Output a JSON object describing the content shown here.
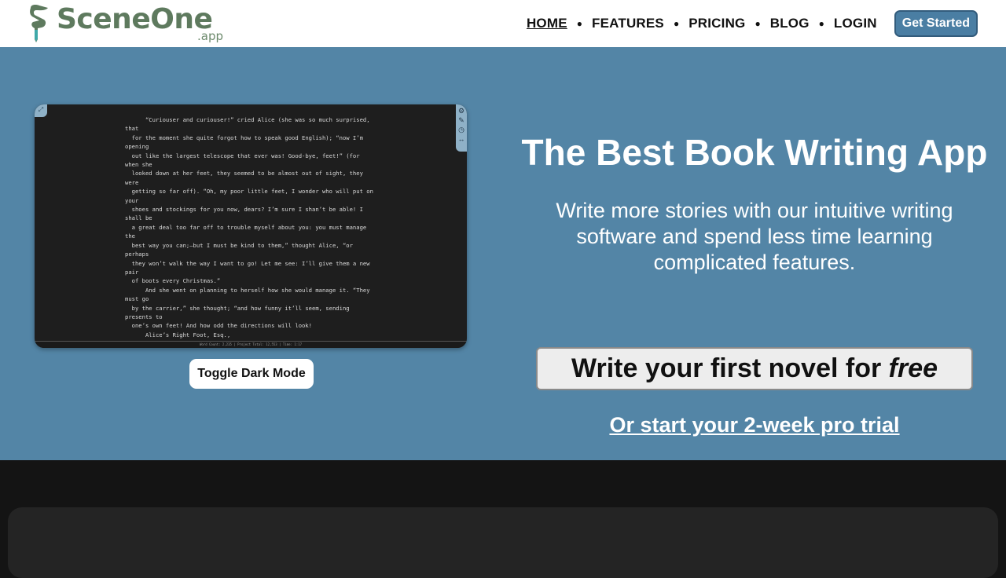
{
  "brand": {
    "name": "SceneOne",
    "suffix": ".app",
    "color": "#5e7a5e"
  },
  "nav": {
    "items": [
      {
        "label": "HOME",
        "active": true
      },
      {
        "label": "FEATURES"
      },
      {
        "label": "PRICING"
      },
      {
        "label": "BLOG"
      },
      {
        "label": "LOGIN"
      }
    ],
    "cta_label": "Get Started"
  },
  "hero": {
    "background": "#5385a6",
    "title": "The Best Book Writing App",
    "subtitle": "Write more stories with our intuitive writing software and spend less time learning complicated features.",
    "primary_cta_prefix": "Write your first novel for ",
    "primary_cta_emphasis": "free",
    "secondary_cta": "Or start your 2-week pro trial",
    "toggle_label": "Toggle Dark Mode"
  },
  "editor": {
    "corner_icon": "expand-icon",
    "toolbar_icons": [
      "settings-icon",
      "pen-icon",
      "clock-icon",
      "width-icon"
    ],
    "text": "      “Curiouser and curiouser!” cried Alice (she was so much surprised, that\n  for the moment she quite forgot how to speak good English); “now I’m opening\n  out like the largest telescope that ever was! Good-bye, feet!” (for when she\n  looked down at her feet, they seemed to be almost out of sight, they were\n  getting so far off). “Oh, my poor little feet, I wonder who will put on your\n  shoes and stockings for you now, dears? I’m sure I shan’t be able! I shall be\n  a great deal too far off to trouble myself about you: you must manage the\n  best way you can;—but I must be kind to them,” thought Alice, “or perhaps\n  they won’t walk the way I want to go! Let me see: I’ll give them a new pair\n  of boots every Christmas.”\n      And she went on planning to herself how she would manage it. “They must go\n  by the carrier,” she thought; “and how funny it’ll seem, sending presents to\n  one’s own feet! And how odd the directions will look!\n      Alice’s Right Foot, Esq.,\n        Hearthrug,\n          near the Fender,\n            (with Alice’s love).\n      Oh dear, what nonsense I’m talking!”\n      Just then her head struck against the roof of the hall: in fact she was\n  now more than nine feet high, and she at once took up the little golden key\n  and hurried off to the garden door.\n      Poor Alice! It was as much as she could do, lying down on one side, to\n  look through into the garden with one eye; but to get through was more\n  hopeless than ever: she sat down and began to cry again.\n      “You ought to be ashamed of yourself,” said Alice, “a great girl like",
    "status": "Word Count: 2,235 | Project Total: 12,553 | Time: 1:17"
  }
}
